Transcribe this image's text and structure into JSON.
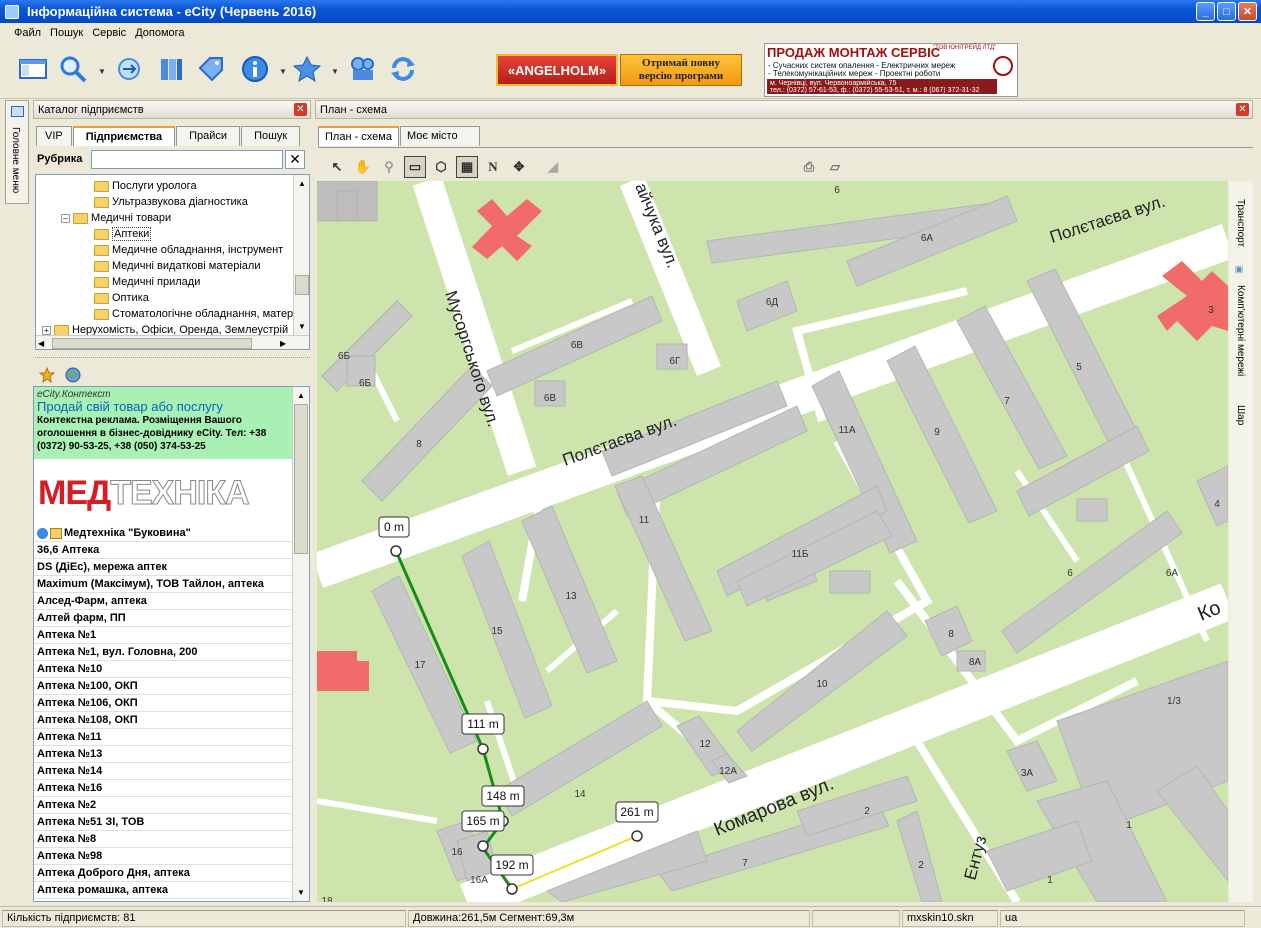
{
  "window": {
    "title": "Інформаційна система - eCity (Червень 2016)"
  },
  "menu": [
    "Файл",
    "Пошук",
    "Сервіс",
    "Допомога"
  ],
  "ads": {
    "angelholm": "«ANGELHOLM»",
    "full_version_line1": "Отримай повну",
    "full_version_line2": "версію програми",
    "banner_title": "ПРОДАЖ МОНТАЖ СЕРВІС",
    "banner_company": "\"ТОВ ЮНІТРЕЙД ЛТД\"",
    "banner_line1": "- Сучасних систем опалення - Електричних мереж",
    "banner_line2": "- Телекомунікаційних мереж - Проектні роботи",
    "banner_address": "м. Чернівці, вул. Червоноармійська, 75",
    "banner_phones": "тел.: (0372) 57-61-53, ф.: (0372) 55-53-51, т. м.: 8 (067) 372-31-32"
  },
  "left_strip": {
    "label": "Головне меню"
  },
  "catalog": {
    "title": "Каталог підприємств",
    "tabs": [
      "VIP",
      "Підприємства",
      "Прайси",
      "Пошук"
    ],
    "active_tab": "Підприємства",
    "rubric_label": "Рубрика",
    "rubric_value": "",
    "tree": [
      {
        "label": "Послуги уролога",
        "level": 3
      },
      {
        "label": "Ультразвукова діагностика",
        "level": 3
      },
      {
        "label": "Медичні товари",
        "level": 2,
        "expanded": true
      },
      {
        "label": "Аптеки",
        "level": 3,
        "selected": true
      },
      {
        "label": "Медичне обладнання, інструмент",
        "level": 3
      },
      {
        "label": "Медичні видаткові матеріали",
        "level": 3
      },
      {
        "label": "Медичні прилади",
        "level": 3
      },
      {
        "label": "Оптика",
        "level": 3
      },
      {
        "label": "Стоматологічне обладнання, матер",
        "level": 3
      },
      {
        "label": "Нерухомість, Офіси, Оренда, Землеустрій",
        "level": 1,
        "collapsed": true
      }
    ]
  },
  "context_ad": {
    "brand": "eCity.Контекст",
    "headline": "Продай свій товар або послугу",
    "body": "Контекстна реклама. Розміщення Вашого оголошення в бізнес-довіднику eCity. Тел: +38 (0372) 90-53-25, +38 (050) 374-53-25",
    "logo_red": "МЕД",
    "logo_outline": "ТЕХНІКА"
  },
  "businesses": [
    "Медтехніка \"Буковина\"",
    "36,6 Аптека",
    "DS (ДіЕс), мережа аптек",
    "Maximum (Максімум), ТОВ Тайлон, аптека",
    "Алсед-Фарм, аптека",
    "Алтей фарм, ПП",
    "Аптека №1",
    "Аптека №1, вул. Головна, 200",
    "Аптека №10",
    "Аптека №100, ОКП",
    "Аптека №106, ОКП",
    "Аптека №108, ОКП",
    "Аптека №11",
    "Аптека №13",
    "Аптека №14",
    "Аптека №16",
    "Аптека №2",
    "Аптека №51 ЗІ, ТОВ",
    "Аптека №8",
    "Аптека №98",
    "Аптека Доброго Дня, аптека",
    "Аптека ромашка, аптека"
  ],
  "map_panel": {
    "title": "План - схема",
    "tabs": [
      "План - схема",
      "Моє місто"
    ],
    "active_tab": "План - схема",
    "side_tabs": [
      "Транспорт",
      "Комп'ютерні мережі",
      "Шар"
    ]
  },
  "map": {
    "streets": [
      "Полєтаєва вул.",
      "Мусоргського вул.",
      "Полєтаєва вул.",
      "Комарова вул.",
      "айчука вул.",
      "Ко",
      "Ентуз"
    ],
    "buildings": [
      "6",
      "6А",
      "6Д",
      "6Б",
      "6Б",
      "6В",
      "6В",
      "6Г",
      "8",
      "3",
      "5",
      "7",
      "9",
      "11А",
      "11",
      "11Б",
      "13",
      "15",
      "17",
      "4",
      "6",
      "6А",
      "8",
      "8А",
      "10",
      "12",
      "12А",
      "14",
      "16",
      "16А",
      "18",
      "1/3",
      "3А",
      "1",
      "2",
      "2",
      "7",
      "1"
    ],
    "measure_labels": [
      "0 m",
      "111 m",
      "148 m",
      "165 m",
      "192 m",
      "261 m"
    ]
  },
  "status": {
    "count": "Кількість підприємств: 81",
    "measure": "Довжина:261,5м   Сегмент:69,3м",
    "skin": "mxskin10.skn",
    "lang": "ua"
  }
}
